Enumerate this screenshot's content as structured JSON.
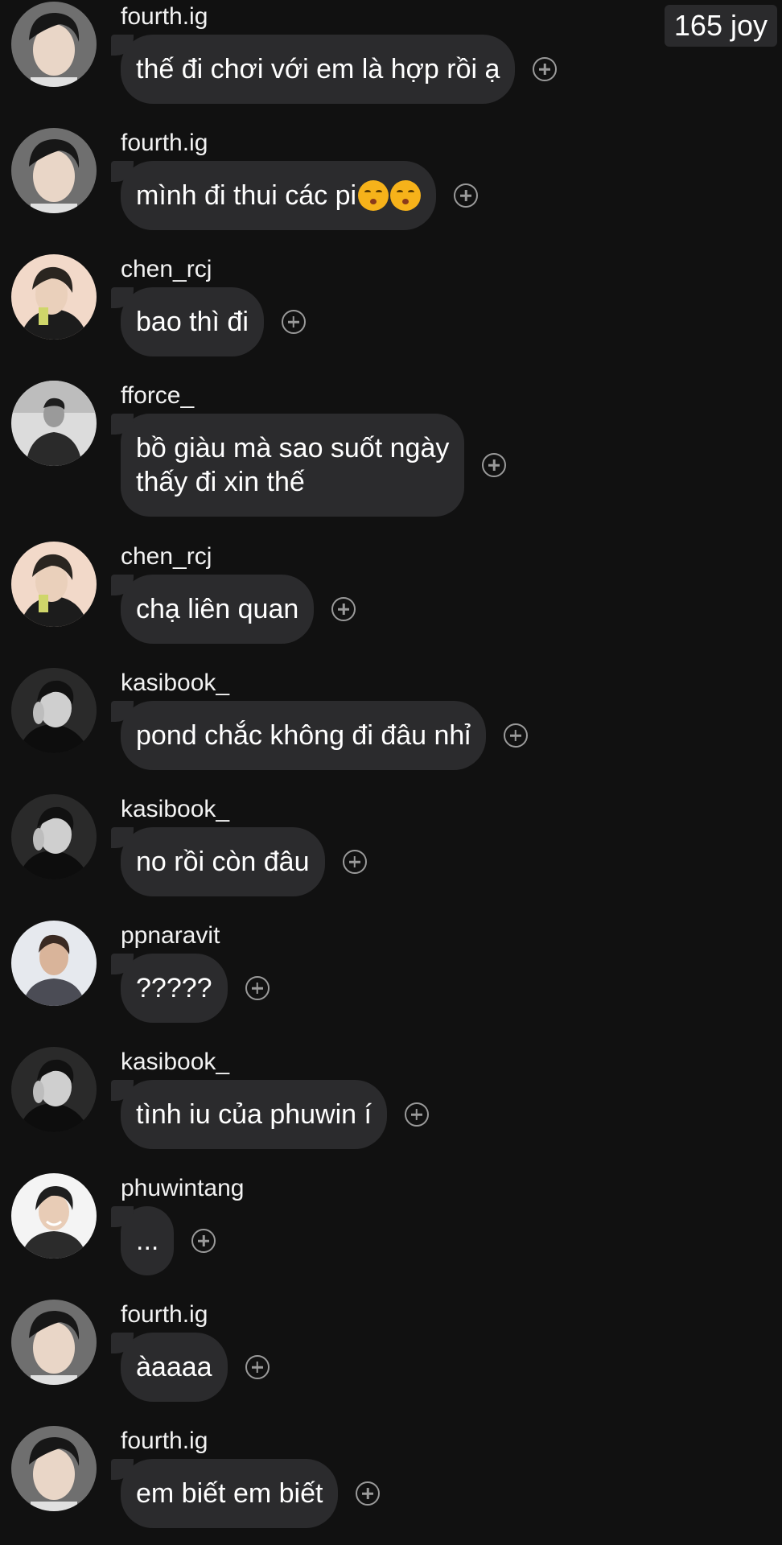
{
  "header": {
    "badge": "165 joy"
  },
  "messages": [
    {
      "user": "fourth.ig",
      "text": "thế đi chơi với em là hợp rồi ạ",
      "avatar": "fourth"
    },
    {
      "user": "fourth.ig",
      "text": "mình đi thui các pi ",
      "emoji": [
        "kissing-face-icon",
        "kissing-face-icon"
      ],
      "avatar": "fourth"
    },
    {
      "user": "chen_rcj",
      "text": "bao thì đi",
      "avatar": "chen"
    },
    {
      "user": "fforce_",
      "text": "bồ giàu mà sao suốt ngày\nthấy đi xin thế",
      "avatar": "fforce"
    },
    {
      "user": "chen_rcj",
      "text": "chạ liên quan",
      "avatar": "chen"
    },
    {
      "user": "kasibook_",
      "text": "pond chắc không đi đâu nhỉ",
      "avatar": "kasi"
    },
    {
      "user": "kasibook_",
      "text": "no rồi còn đâu",
      "avatar": "kasi"
    },
    {
      "user": "ppnaravit",
      "text": "?????",
      "avatar": "pp"
    },
    {
      "user": "kasibook_",
      "text": "tình iu của phuwin í",
      "avatar": "kasi"
    },
    {
      "user": "phuwintang",
      "text": "...",
      "avatar": "phuwin"
    },
    {
      "user": "fourth.ig",
      "text": "àaaaa",
      "avatar": "fourth"
    },
    {
      "user": "fourth.ig",
      "text": "em biết em biết",
      "avatar": "fourth"
    }
  ],
  "colors": {
    "background": "#111111",
    "bubble": "#2b2b2d",
    "text": "#ffffff",
    "reaction_icon": "#9a9a9a"
  }
}
